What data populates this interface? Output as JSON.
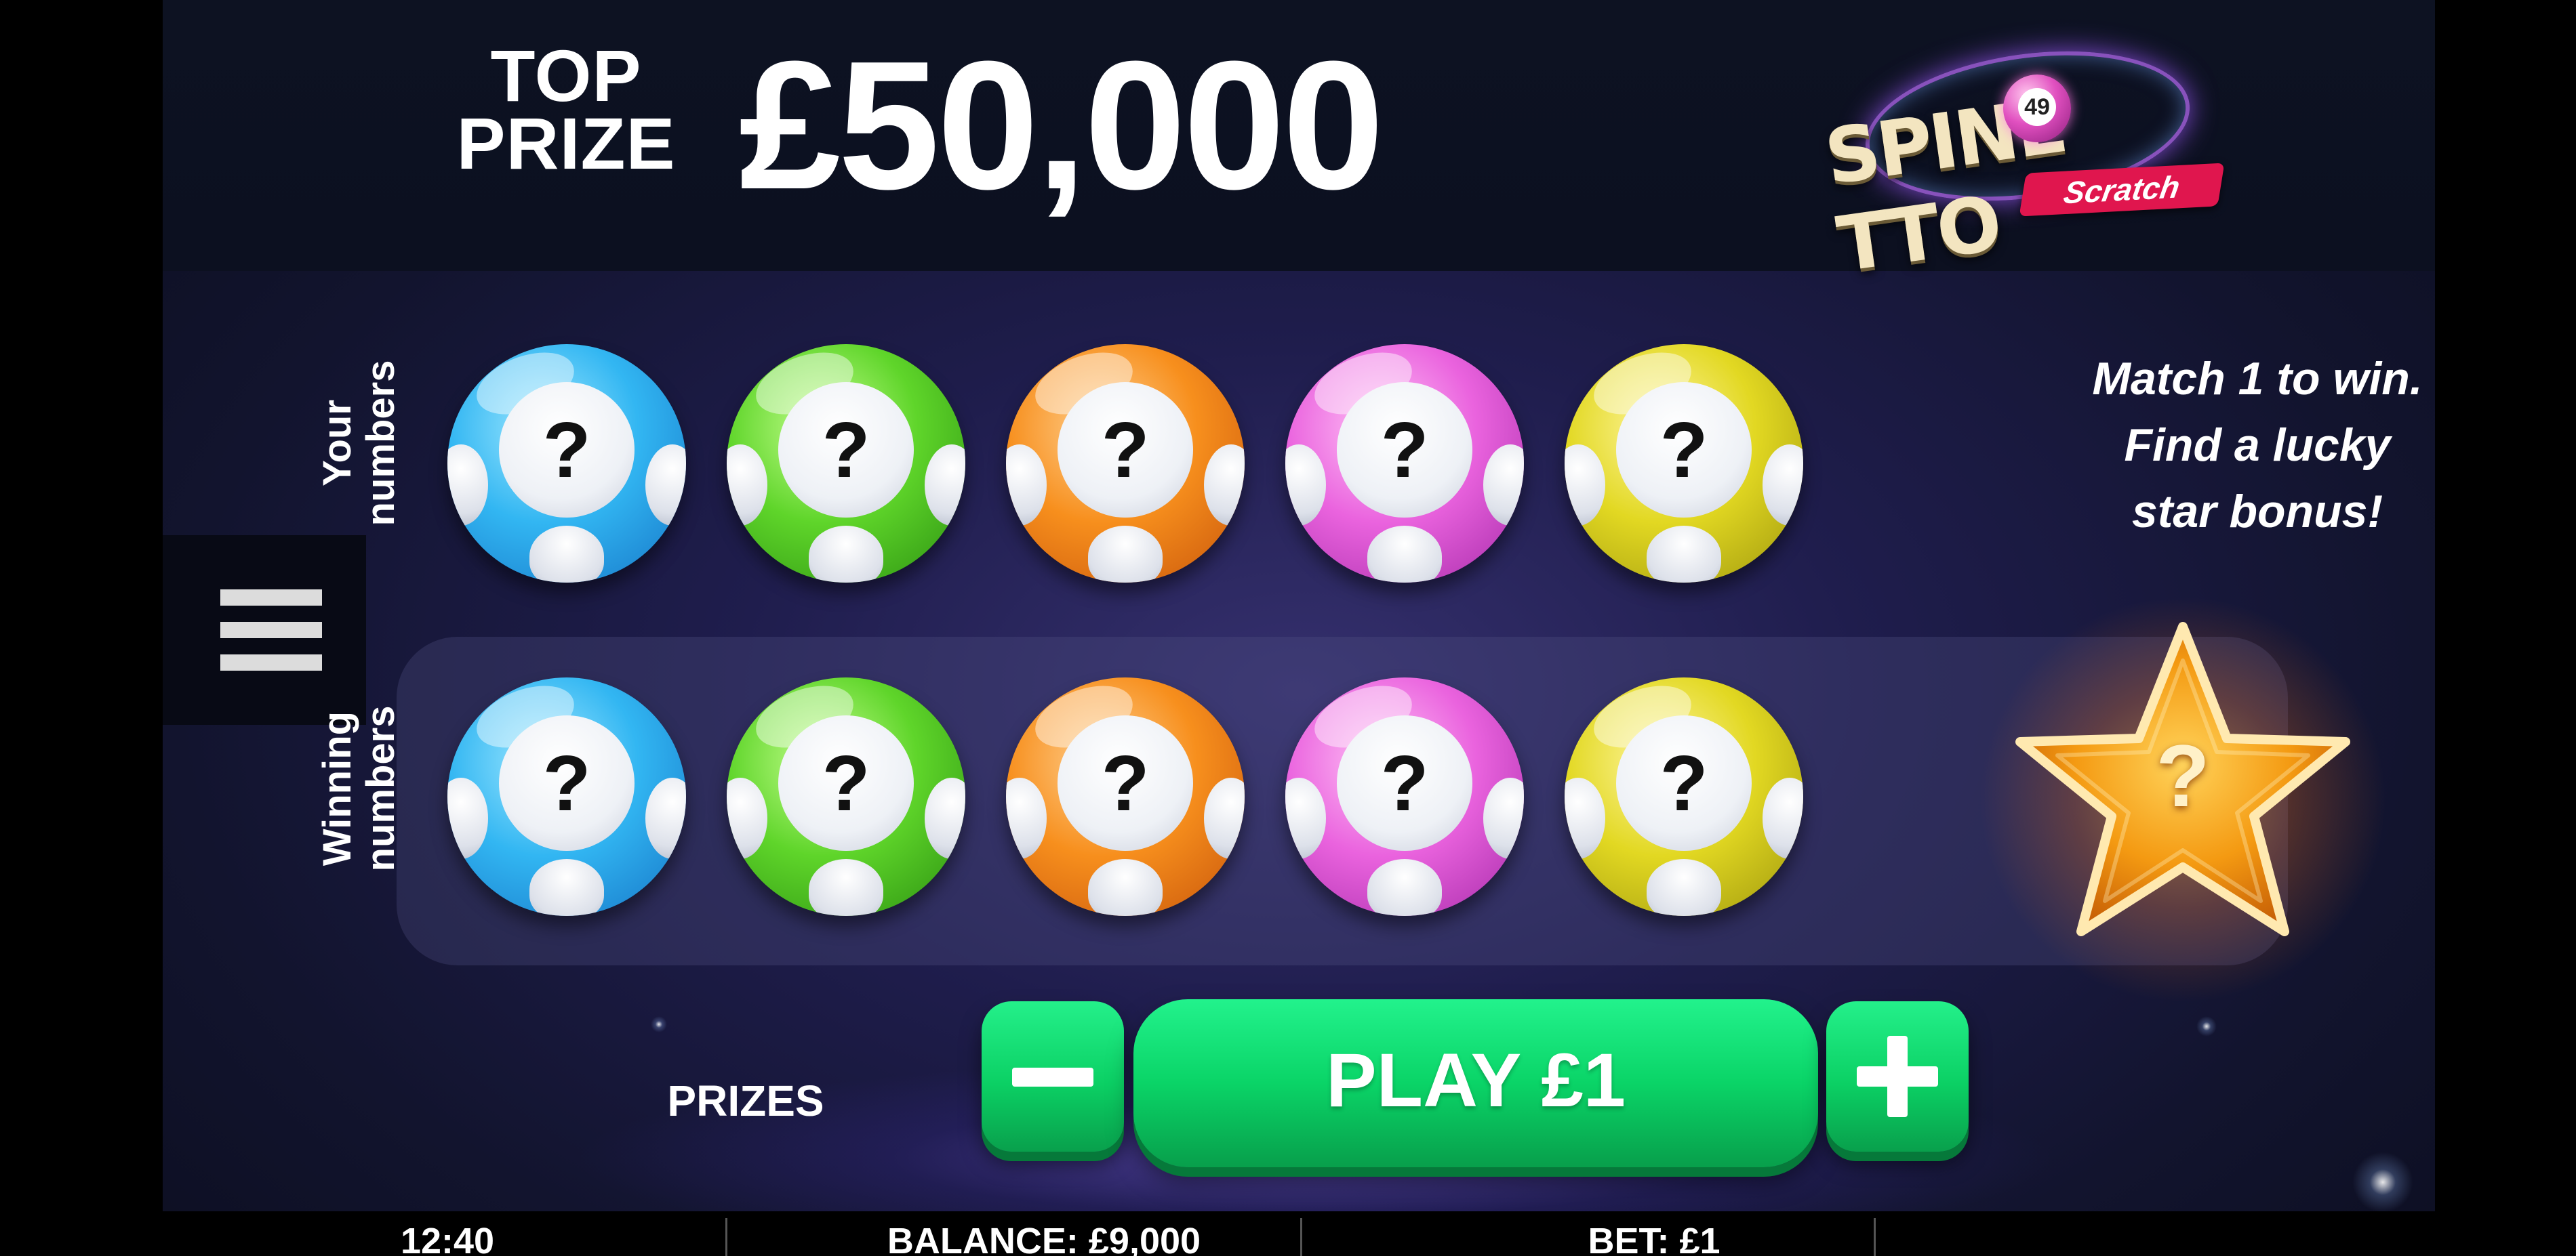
{
  "header": {
    "top_label_line1": "TOP",
    "top_label_line2": "PRIZE",
    "top_amount": "£50,000",
    "logo": {
      "text_left": "SPINL",
      "text_right": "TTO",
      "ball_number": "49",
      "sub": "Scratch"
    }
  },
  "labels": {
    "your_numbers": "Your numbers",
    "winning_numbers": "Winning numbers"
  },
  "your_numbers": [
    {
      "color": "blue",
      "value": "?"
    },
    {
      "color": "green",
      "value": "?"
    },
    {
      "color": "orange",
      "value": "?"
    },
    {
      "color": "pink",
      "value": "?"
    },
    {
      "color": "yellow",
      "value": "?"
    }
  ],
  "winning_numbers": [
    {
      "color": "blue",
      "value": "?"
    },
    {
      "color": "green",
      "value": "?"
    },
    {
      "color": "orange",
      "value": "?"
    },
    {
      "color": "pink",
      "value": "?"
    },
    {
      "color": "yellow",
      "value": "?"
    }
  ],
  "instructions": {
    "line1": "Match 1 to win.",
    "line2": "Find a lucky",
    "line3": "star bonus!"
  },
  "bonus_star": {
    "value": "?"
  },
  "controls": {
    "prizes": "PRIZES",
    "play": "PLAY £1",
    "decrease_icon": "minus-icon",
    "increase_icon": "plus-icon"
  },
  "menu": {
    "icon": "hamburger-menu-icon"
  },
  "status": {
    "time": "12:40",
    "balance": "BALANCE: £9,000",
    "bet": "BET: £1"
  },
  "colors": {
    "play_green": "#0bd064",
    "background": "#1f1d4d",
    "scratch_badge": "#e0164e"
  }
}
